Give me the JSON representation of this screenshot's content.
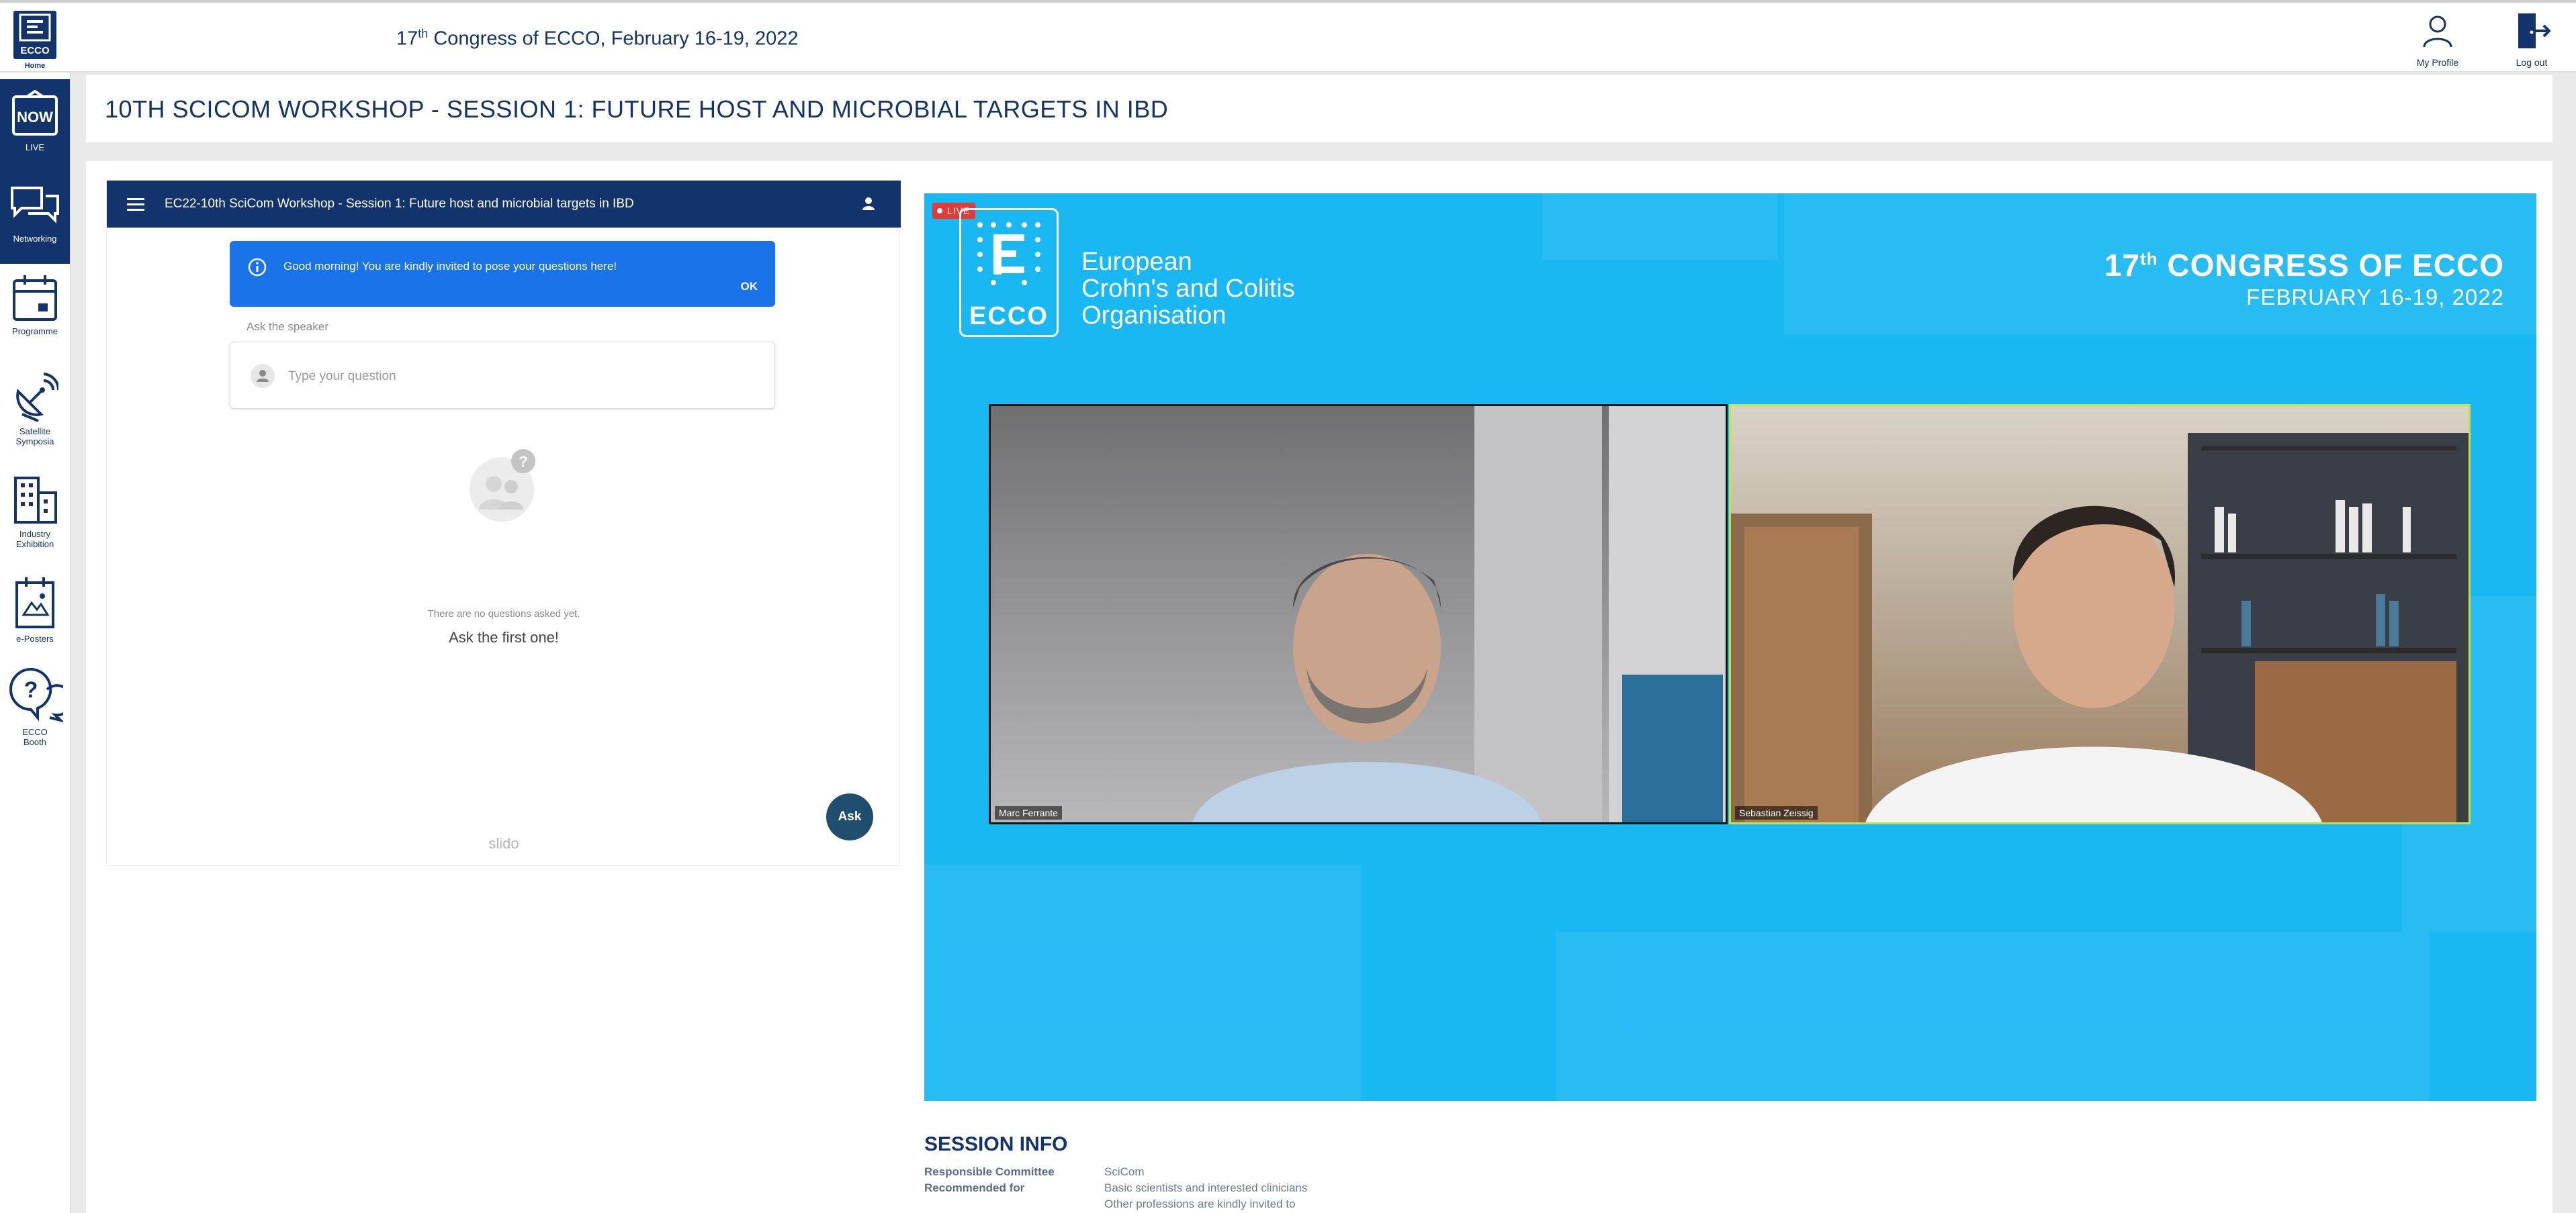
{
  "header": {
    "home_label": "Home",
    "home_logo_text": "ECCO",
    "congress_prefix": "17",
    "congress_sup": "th",
    "congress_suffix": " Congress of ECCO, February 16-19, 2022",
    "profile_label": "My Profile",
    "logout_label": "Log out",
    "profile_icon": "user-icon",
    "logout_icon": "logout-icon"
  },
  "sidebar": {
    "items": [
      {
        "label": "LIVE",
        "icon": "now-icon",
        "icon_text": "NOW",
        "active": true
      },
      {
        "label": "Networking",
        "icon": "chat-icon",
        "active": true
      },
      {
        "label": "Programme",
        "icon": "calendar-icon"
      },
      {
        "label_line1": "Satellite",
        "label_line2": "Symposia",
        "icon": "satellite-icon"
      },
      {
        "label_line1": "Industry",
        "label_line2": "Exhibition",
        "icon": "building-icon"
      },
      {
        "label": "e-Posters",
        "icon": "poster-icon"
      },
      {
        "label_line1": "ECCO",
        "label_line2": "Booth",
        "icon": "help-chat-icon"
      }
    ]
  },
  "page": {
    "title": "10TH SCICOM WORKSHOP - SESSION 1: FUTURE HOST AND MICROBIAL TARGETS IN IBD"
  },
  "slido": {
    "header_title": "EC22-10th SciCom Workshop - Session 1: Future host and microbial targets in IBD",
    "banner_text": "Good morning! You are kindly invited to pose your questions here!",
    "banner_ok": "OK",
    "ask_label": "Ask the speaker",
    "question_placeholder": "Type your question",
    "empty_text": "There are no questions asked yet.",
    "empty_cta": "Ask the first one!",
    "ask_button": "Ask",
    "brand": "slido"
  },
  "video": {
    "live_badge": "LIVE",
    "logo_text": "ECCO",
    "org_line1": "European",
    "org_line2": "Crohn's and Colitis",
    "org_line3": "Organisation",
    "banner_prefix": "17",
    "banner_sup": "th",
    "banner_suffix": " CONGRESS OF ECCO",
    "banner_dates": "FEBRUARY 16-19, 2022",
    "speakers": [
      {
        "name": "Marc Ferrante"
      },
      {
        "name": "Sebastian Zeissig"
      }
    ]
  },
  "session_info": {
    "title": "SESSION INFO",
    "rows": [
      {
        "label": "Responsible Committee",
        "value": "SciCom"
      },
      {
        "label": "Recommended for",
        "value": "Basic scientists and interested clinicians"
      }
    ],
    "extra_line": "Other professions are kindly invited to"
  },
  "colors": {
    "brand_navy": "#12336b",
    "video_blue": "#1ab8f2",
    "slido_blue": "#1a73e8",
    "live_red": "#e53935",
    "ask_button": "#1f4e6e"
  }
}
